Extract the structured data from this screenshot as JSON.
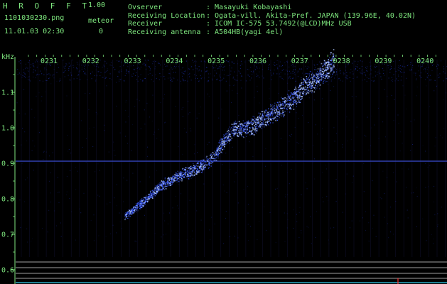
{
  "header": {
    "app_title_letters": [
      "H",
      "R",
      "O",
      "F",
      "F",
      "T"
    ],
    "version": "1.00",
    "filename": "1101030230.png",
    "meteor_label": "meteor",
    "datetime": "11.01.03 02:30",
    "meteor_count": "0"
  },
  "info": {
    "rows": [
      {
        "label": "Ovserver",
        "value": ": Masayuki Kobayashi"
      },
      {
        "label": "Receiving Location",
        "value": ": Ogata-vill. Akita-Pref. JAPAN (139.96E, 40.02N)"
      },
      {
        "label": "Receiver",
        "value": ": ICOM IC-575 53.7492(@LCD)MHz USB"
      },
      {
        "label": "Receiving antenna",
        "value": ": A504HB(yagi 4el)"
      }
    ]
  },
  "axes": {
    "y_unit": "kHz",
    "y_ticks": [
      {
        "value": 1.1,
        "label": "1.1"
      },
      {
        "value": 1.0,
        "label": "1.0"
      },
      {
        "value": 0.9,
        "label": "0.9"
      },
      {
        "value": 0.8,
        "label": "0.8"
      },
      {
        "value": 0.7,
        "label": "0.7"
      },
      {
        "value": 0.6,
        "label": "0.6"
      }
    ],
    "x_ticks": [
      "0231",
      "0232",
      "0233",
      "0234",
      "0235",
      "0236",
      "0237",
      "0238",
      "0239",
      "0240"
    ]
  },
  "colors": {
    "text": "#7fe87f",
    "background": "#000000",
    "signal": "#3a5aff",
    "signal_bright": "#b0c8ff",
    "noise": "#1a2a9a",
    "gridline": "#2a2a70",
    "horizontal_lines": "#c8c8c8",
    "cursor_line": "#ff3030"
  }
}
